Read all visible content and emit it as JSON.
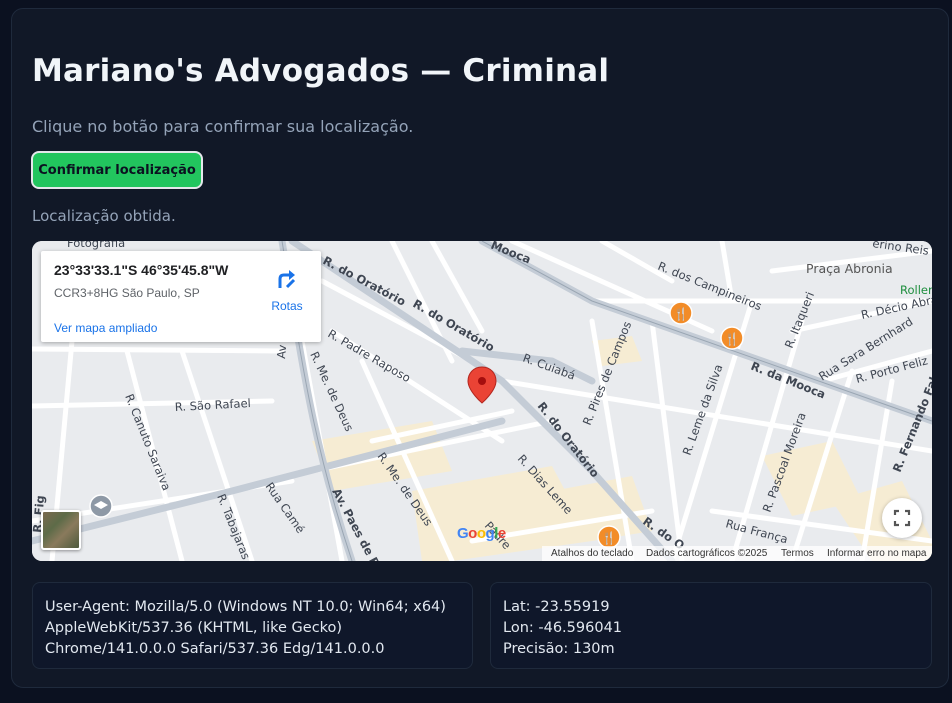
{
  "page": {
    "title": "Mariano's Advogados — Criminal",
    "subtitle": "Clique no botão para confirmar sua localização.",
    "confirm_button": "Confirmar localização",
    "status": "Localização obtida."
  },
  "map": {
    "info_card": {
      "coords": "23°33'33.1\"S 46°35'45.8\"W",
      "plus_code": "CCR3+8HG São Paulo, SP",
      "directions_label": "Rotas",
      "larger_map_link": "Ver mapa ampliado"
    },
    "streets": {
      "oratorio_top": "R. do Oratório",
      "oratorio_mid": "R. do Oratório",
      "oratorio_low": "R. do Oratório",
      "oratorio_edge": "R. do O",
      "padre_raposo": "R. Padre Raposo",
      "me_de_deus_top": "R. Me. de Deus",
      "me_de_deus_bottom": "R. Me. de Deus",
      "sao_rafael": "R. São Rafael",
      "canuto_saraiva": "R. Canuto Saraiva",
      "tabajaras": "R. Tabajaras",
      "rua_came": "Rua Camé",
      "paes_de_barros": "Av. Paes de Ba",
      "cuiaba": "R. Cuiabá",
      "pires_de_campos": "R. Pires de Campos",
      "dias_leme": "R. Dias Leme",
      "leme_da_silva": "R. Leme da Silva",
      "pascoal_moreira": "R. Pascoal Moreira",
      "rua_franca": "Rua França",
      "dos_campineiros": "R. dos Campineiros",
      "itaqueri": "R. Itaqueri",
      "da_mooca": "R. da Mooca",
      "mooca_top": "Mooca",
      "sara_bernhard": "Rua Sara Bernhard",
      "porto_feliz": "R. Porto Feliz",
      "decio_abra": "R. Décio Abra",
      "fernando_falcao": "R. Fernando Falc",
      "praca_abronia": "Praça Abronia",
      "fotografia": "Fotografia",
      "padre_bottom": "Padre",
      "av_side": "Av",
      "r_fig": "R. Fig",
      "serino": "erino Reis",
      "roller": "Roller"
    },
    "google_logo": "Google",
    "footer": {
      "keyboard": "Atalhos do teclado",
      "map_data": "Dados cartográficos ©2025",
      "terms": "Termos",
      "report": "Informar erro no mapa"
    },
    "icons": {
      "pin_color": "#ea4335",
      "restaurant_color": "#f28c28",
      "school_color": "#7b8794"
    }
  },
  "device_info": {
    "line1": "User-Agent: Mozilla/5.0 (Windows NT 10.0; Win64; x64)",
    "line2": "AppleWebKit/537.36 (KHTML, like Gecko)",
    "line3": "Chrome/141.0.0.0 Safari/537.36 Edg/141.0.0.0"
  },
  "location_info": {
    "lat": "Lat: -23.55919",
    "lon": "Lon: -46.596041",
    "precision": "Precisão: 130m"
  },
  "colors": {
    "background": "#0b1120",
    "card": "#111827",
    "accent_green": "#22c55e",
    "muted_text": "#94a3b8"
  }
}
